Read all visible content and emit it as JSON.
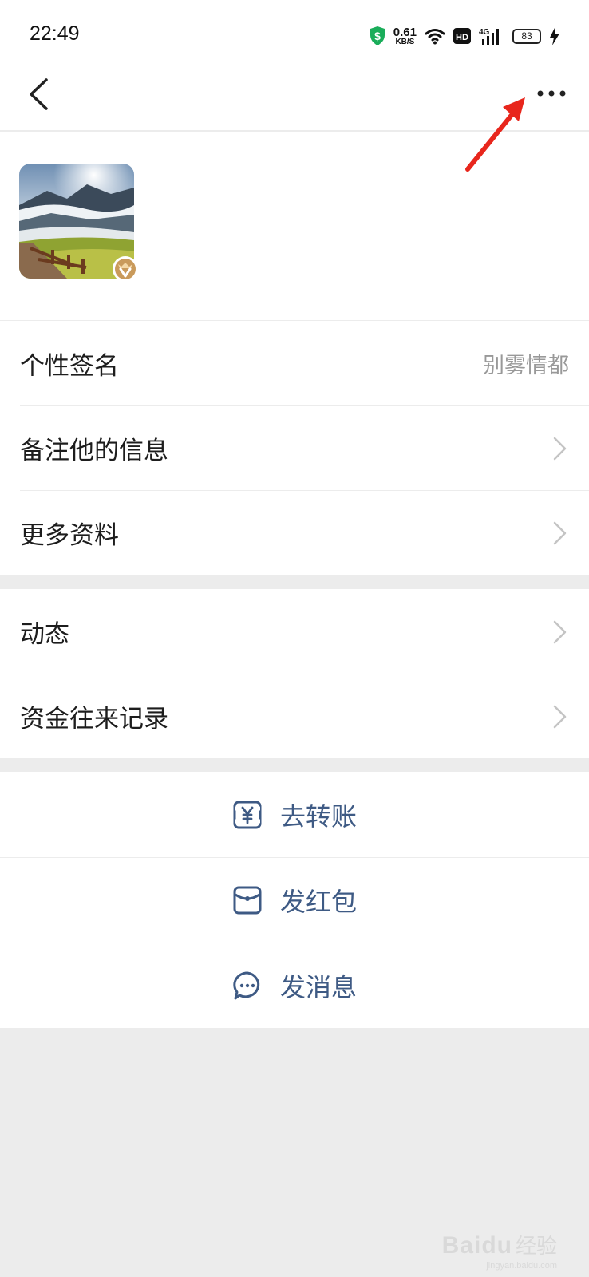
{
  "status_bar": {
    "time": "22:49",
    "net_speed_value": "0.61",
    "net_speed_unit": "KB/S",
    "hd": "HD",
    "network": "4G",
    "battery": "83"
  },
  "profile": {
    "avatar_icon": "landscape-avatar",
    "badge_icon": "vip-badge-icon"
  },
  "info_rows": [
    {
      "label": "个性签名",
      "value": "别雾情都"
    },
    {
      "label": "备注他的信息"
    },
    {
      "label": "更多资料"
    }
  ],
  "activity_rows": [
    {
      "label": "动态"
    },
    {
      "label": "资金往来记录"
    }
  ],
  "actions": [
    {
      "label": "去转账",
      "icon": "transfer-icon"
    },
    {
      "label": "发红包",
      "icon": "red-packet-icon"
    },
    {
      "label": "发消息",
      "icon": "message-icon"
    }
  ],
  "watermark": {
    "brand": "Baidu",
    "cn": "经验",
    "url": "jingyan.baidu.com"
  },
  "colors": {
    "action_text": "#3e5a84",
    "secondary_text": "#999999",
    "page_bg": "#ececec",
    "annotation_arrow": "#e8261c"
  }
}
